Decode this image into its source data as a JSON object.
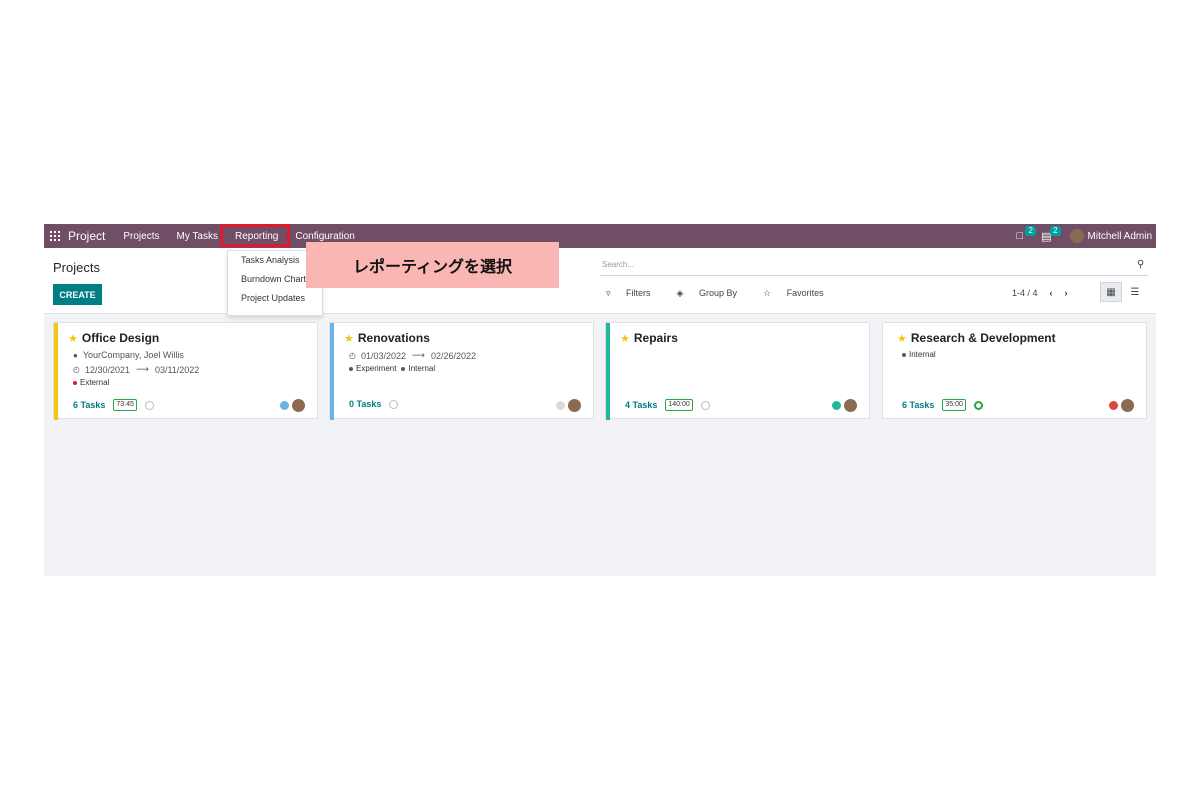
{
  "navbar": {
    "app_title": "Project",
    "menu": [
      "Projects",
      "My Tasks",
      "Reporting",
      "Configuration"
    ],
    "messages_count": "2",
    "activities_count": "2",
    "user_name": "Mitchell Admin"
  },
  "reporting_menu": [
    "Tasks Analysis",
    "Burndown Chart",
    "Project Updates"
  ],
  "callout_text": "レポーティングを選択",
  "control_panel": {
    "title": "Projects",
    "create_label": "CREATE",
    "search_placeholder": "Search...",
    "filters_label": "Filters",
    "group_by_label": "Group By",
    "favorites_label": "Favorites",
    "pager": "1-4 / 4"
  },
  "projects": [
    {
      "name": "Office Design",
      "customer": "YourCompany, Joel Willis",
      "date_start": "12/30/2021",
      "date_end": "03/11/2022",
      "tags": [
        "External"
      ],
      "tasks": "6 Tasks",
      "hours": "73:45",
      "stripe_color": "#f3c614",
      "status_color": "#6cb4e4",
      "tag_colors": [
        "#e0182d"
      ]
    },
    {
      "name": "Renovations",
      "date_start": "01/03/2022",
      "date_end": "02/26/2022",
      "tags": [
        "Experiment",
        "Internal"
      ],
      "tasks": "0 Tasks",
      "stripe_color": "#6cb4e4",
      "status_color": "#d9d9d9",
      "tag_colors": [
        "#714b67",
        "#714b67"
      ]
    },
    {
      "name": "Repairs",
      "tags": [],
      "tasks": "4 Tasks",
      "hours": "140:00",
      "stripe_color": "#21b799",
      "status_color": "#21b799"
    },
    {
      "name": "Research & Development",
      "tags": [
        "Internal"
      ],
      "tasks": "6 Tasks",
      "hours": "35:00",
      "stripe_color": "#ffffff",
      "status_color": "#e0443a",
      "tag_colors": [
        "#714b67"
      ]
    }
  ]
}
